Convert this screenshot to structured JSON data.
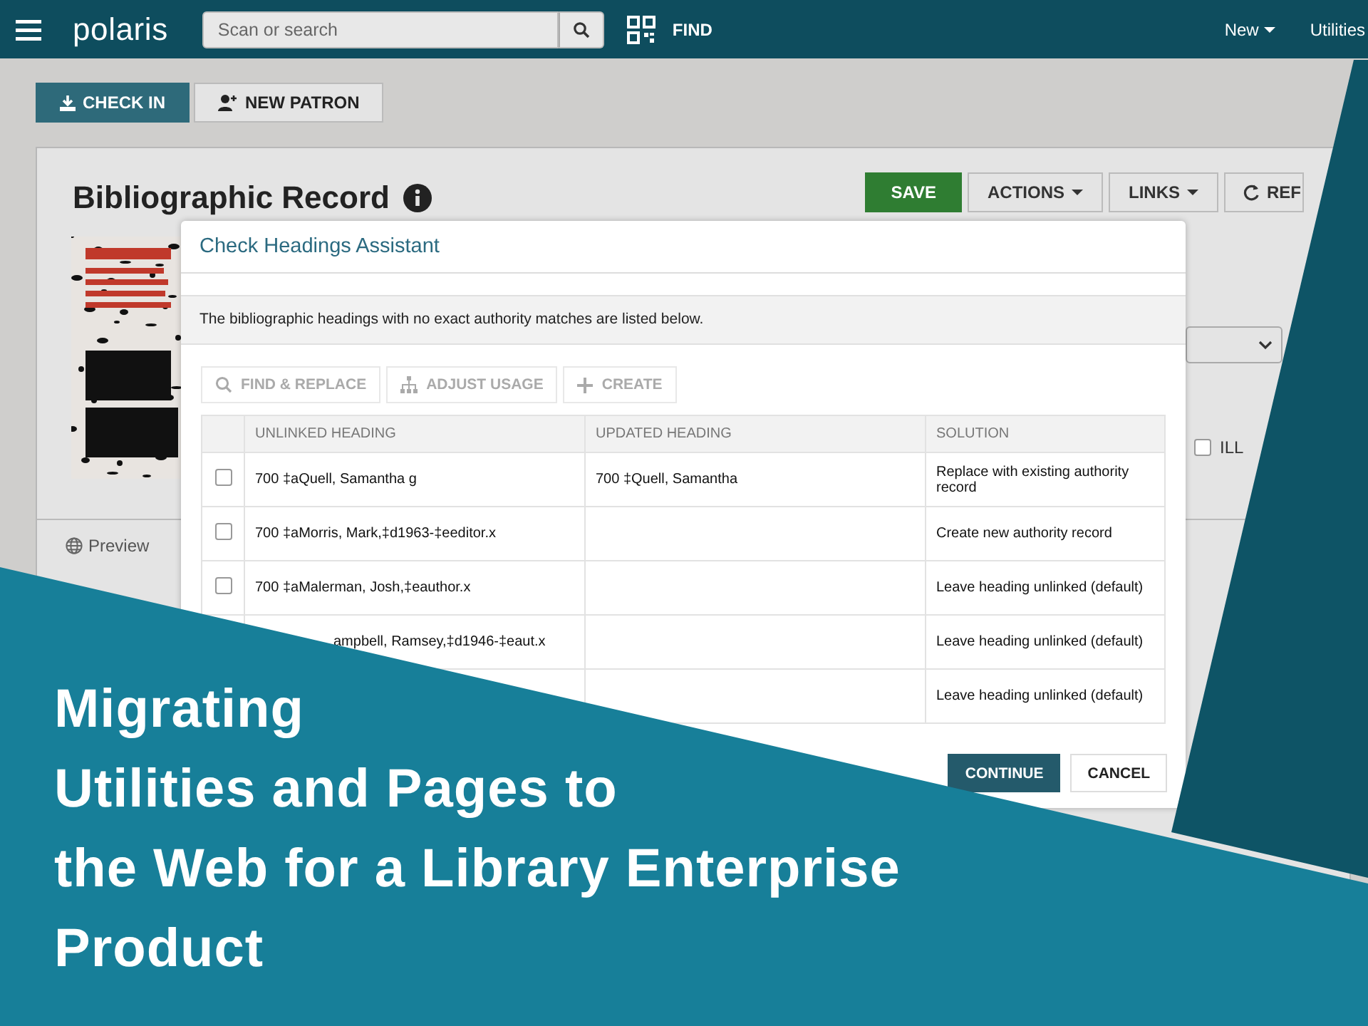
{
  "header": {
    "logo": "polaris",
    "search": {
      "placeholder": "Scan or search"
    },
    "find_label": "FIND",
    "menus": [
      "New",
      "Utilities"
    ]
  },
  "toolbar": {
    "buttons": [
      {
        "label": "CHECK IN",
        "kind": "primary"
      },
      {
        "label": "NEW PATRON",
        "kind": "secondary"
      }
    ]
  },
  "record": {
    "title": "Bibliographic Record",
    "actions": [
      {
        "label": "SAVE",
        "kind": "save"
      },
      {
        "label": "ACTIONS",
        "kind": "dropdown"
      },
      {
        "label": "LINKS",
        "kind": "dropdown"
      },
      {
        "label": "REF",
        "kind": "refresh"
      }
    ],
    "ill": {
      "label": "ILL",
      "checked": false
    },
    "tabs": [
      {
        "label": "Preview",
        "kind": "globe"
      }
    ]
  },
  "dialog": {
    "title": "Check Headings Assistant",
    "description": "The bibliographic headings with no exact authority matches are listed below.",
    "tools": [
      {
        "label": "FIND & REPLACE",
        "kind": "find",
        "disabled": true
      },
      {
        "label": "ADJUST USAGE",
        "kind": "usage",
        "disabled": true
      },
      {
        "label": "CREATE",
        "kind": "create",
        "disabled": true
      }
    ],
    "columns": [
      "UNLINKED HEADING",
      "UPDATED HEADING",
      "SOLUTION"
    ],
    "rows": [
      {
        "kind": "full",
        "checked": false,
        "unlinked": "700 ‡aQuell, Samantha g",
        "updated": "700 ‡Quell, Samantha",
        "solution": "Replace with existing authority record"
      },
      {
        "kind": "full",
        "checked": false,
        "unlinked": "700 ‡aMorris, Mark,‡d1963-‡eeditor.x",
        "solution": "Create new authority record"
      },
      {
        "kind": "full",
        "checked": false,
        "unlinked": "700 ‡aMalerman, Josh,‡eauthor.x",
        "solution": "Leave heading unlinked (default)"
      },
      {
        "kind": "covered",
        "unlinked": "ampbell, Ramsey,‡d1946-‡eaut.x",
        "solution": "Leave heading unlinked (default)"
      },
      {
        "kind": "covered",
        "solution": "Leave heading unlinked (default)"
      }
    ],
    "buttons": [
      {
        "label": "CONTINUE",
        "kind": "primary"
      },
      {
        "label": "CANCEL",
        "kind": "secondary"
      }
    ]
  },
  "banner": {
    "title_lines": [
      "Migrating",
      "Utilities and Pages to",
      "the Web for a Library Enterprise",
      "Product"
    ]
  }
}
